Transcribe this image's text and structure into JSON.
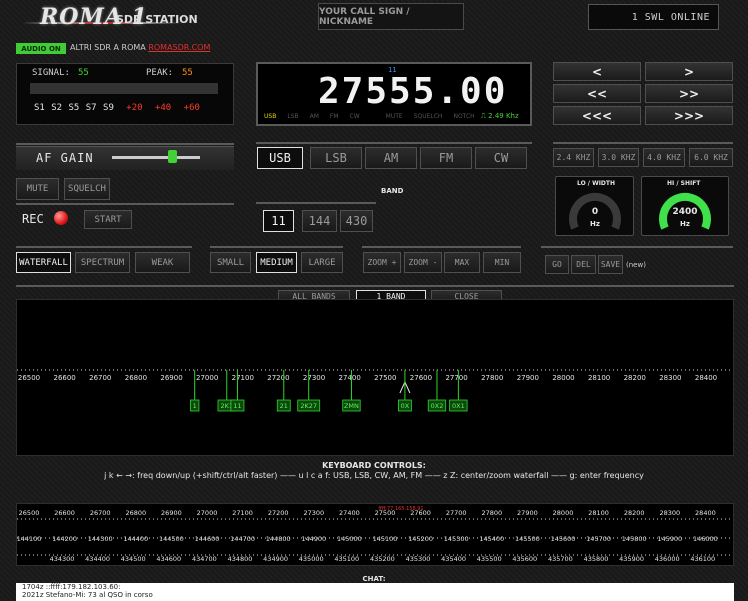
{
  "header": {
    "logo_title": "ROMA 1",
    "logo_subtitle": "SDR STATION",
    "callsign_placeholder": "YOUR CALL SIGN / NICKNAME",
    "online_status": "1 SWL ONLINE",
    "audio_badge": "AUDIO ON",
    "altri_text": "ALTRI SDR A ROMA ",
    "altri_link": "ROMASDR.COM"
  },
  "signal": {
    "signal_label": "SIGNAL:",
    "signal_value": "55",
    "peak_label": "PEAK:",
    "peak_value": "55",
    "scale_white": "S1 S2 S5 S7 S9",
    "scale_red": [
      "+20",
      "+40",
      "+60"
    ]
  },
  "frequency": {
    "value": "27555.00",
    "marker": "11",
    "modes": [
      "USB",
      "LSB",
      "AM",
      "FM",
      "CW",
      "",
      "MUTE",
      "SQUELCH",
      "NOTCH"
    ],
    "active_mode": "USB",
    "bandwidth": "2.49 Khz"
  },
  "tuning": {
    "step_labels": [
      "<",
      ">",
      "<<",
      ">>",
      "<<<",
      ">>>"
    ]
  },
  "audio": {
    "af_gain_label": "AF GAIN",
    "af_gain_level": 0.72,
    "mute_label": "MUTE",
    "squelch_label": "SQUELCH",
    "rec_label": "REC",
    "start_label": "START"
  },
  "modes": {
    "buttons": [
      "USB",
      "LSB",
      "AM",
      "FM",
      "CW"
    ],
    "selected": "USB"
  },
  "filters": {
    "buttons": [
      "2.4 KHZ",
      "3.0 KHZ",
      "4.0 KHZ",
      "6.0 KHZ"
    ]
  },
  "band": {
    "label": "BAND",
    "buttons": [
      "11",
      "144",
      "430"
    ],
    "selected": "11"
  },
  "gauges": {
    "lo_title": "LO / WIDTH",
    "lo_value": "0",
    "lo_unit": "Hz",
    "hi_title": "HI / SHIFT",
    "hi_value": "2400",
    "hi_unit": "Hz",
    "hi_color": "#3fe04a"
  },
  "view": {
    "display_buttons": [
      "WATERFALL",
      "SPECTRUM",
      "WEAK"
    ],
    "display_selected": "WATERFALL",
    "size_buttons": [
      "SMALL",
      "MEDIUM",
      "LARGE"
    ],
    "size_selected": "MEDIUM",
    "zoom_buttons": [
      "ZOOM +",
      "ZOOM -",
      "MAX",
      "MIN"
    ],
    "memory_buttons": [
      "GO",
      "DEL",
      "SAVE"
    ],
    "new_label": "(new)"
  },
  "waterfall": {
    "tabs": [
      "ALL BANDS",
      "1 BAND",
      "CLOSE"
    ],
    "selected_tab": "1 BAND",
    "scale_labels": [
      "26500",
      "26600",
      "26700",
      "26800",
      "26900",
      "27000",
      "27100",
      "27200",
      "27300",
      "27400",
      "27500",
      "27600",
      "27700",
      "27800",
      "27900",
      "28000",
      "28100",
      "28200",
      "28300",
      "28400"
    ],
    "tuned_freq": 27555,
    "markers": [
      {
        "label": "1",
        "freq": 26965
      },
      {
        "label": "2K1",
        "freq": 27055
      },
      {
        "label": "11",
        "freq": 27085
      },
      {
        "label": "21",
        "freq": 27215
      },
      {
        "label": "2K27",
        "freq": 27285
      },
      {
        "label": "ZMN",
        "freq": 27405
      },
      {
        "label": "0X",
        "freq": 27555
      },
      {
        "label": "0X2",
        "freq": 27645
      },
      {
        "label": "0X1",
        "freq": 27705
      }
    ],
    "marker_color": "#2fd42f"
  },
  "keyboard": {
    "title": "KEYBOARD CONTROLS:",
    "text": "j k ← →: freq down/up (+shift/ctrl/alt faster) —— u l c a f: USB, LSB, CW, AM, FM —— z Z: center/zoom waterfall —— g: enter frequency"
  },
  "bottom_scales": {
    "top_ip": "ffff:77.165.158.91",
    "row1": [
      "26500",
      "26600",
      "26700",
      "26800",
      "26900",
      "27000",
      "27100",
      "27200",
      "27300",
      "27400",
      "27500",
      "27600",
      "27700",
      "27800",
      "27900",
      "28000",
      "28100",
      "28200",
      "28300",
      "28400"
    ],
    "row2": [
      "144100",
      "144200",
      "144300",
      "144400",
      "144500",
      "144600",
      "144700",
      "144800",
      "144900",
      "145000",
      "145100",
      "145200",
      "145300",
      "145400",
      "145500",
      "145600",
      "145700",
      "145800",
      "145900",
      "146000"
    ],
    "row3": [
      "434300",
      "434400",
      "434500",
      "434600",
      "434700",
      "434800",
      "434900",
      "435000",
      "435100",
      "435200",
      "435300",
      "435400",
      "435500",
      "435600",
      "435700",
      "435800",
      "435900",
      "436000",
      "436100"
    ]
  },
  "chat": {
    "title": "CHAT:",
    "line1_prefix": "1704z ::ffff:179.182.103.60: ",
    "line1_link": "",
    "line2": "2021z Stefano-Mi: 73 al QSO in corso"
  }
}
